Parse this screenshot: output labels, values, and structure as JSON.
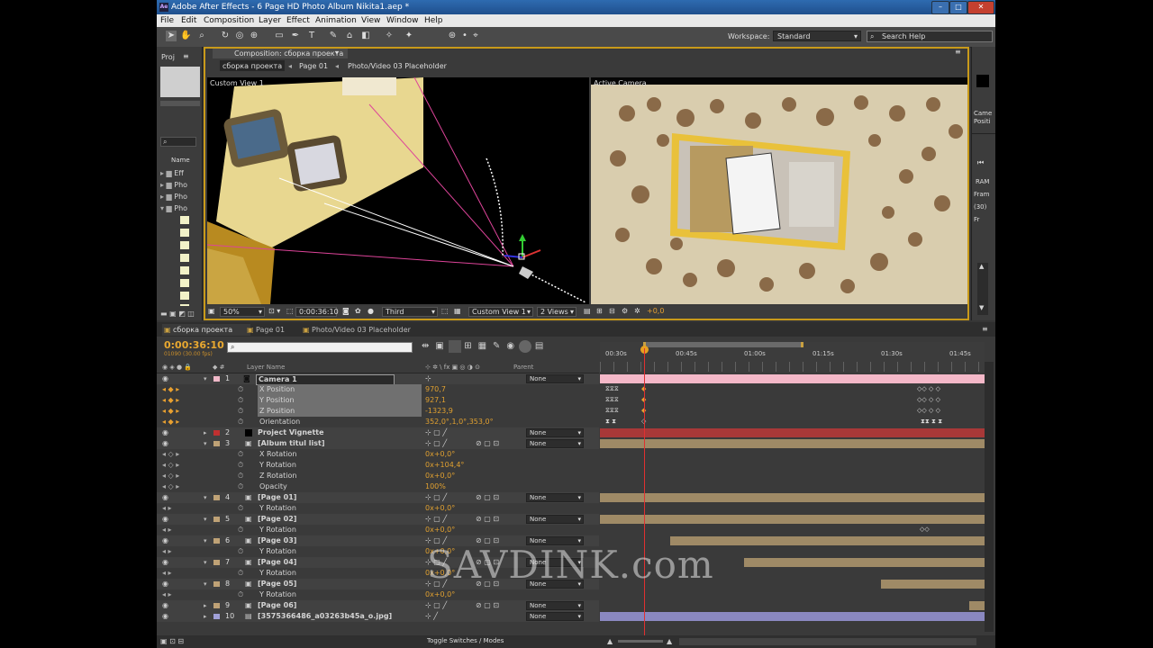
{
  "window": {
    "title": "Adobe After Effects - 6 Page HD Photo Album Nikita1.aep *",
    "minimize": "–",
    "maximize": "□",
    "close": "✕"
  },
  "menu": [
    "File",
    "Edit",
    "Composition",
    "Layer",
    "Effect",
    "Animation",
    "View",
    "Window",
    "Help"
  ],
  "toolbar": {
    "workspace_label": "Workspace:",
    "workspace_value": "Standard",
    "search_placeholder": "Search Help"
  },
  "project_panel": {
    "tab": "Proj",
    "name_col": "Name",
    "items": [
      "Eff",
      "Pho",
      "Pho",
      "Pho"
    ]
  },
  "composition_panel": {
    "tab": "Composition: сборка проекта",
    "breadcrumbs": [
      "сборка проекта",
      "Page 01",
      "Photo/Video 03 Placeholder"
    ],
    "left_view_label": "Custom View 1",
    "right_view_label": "Active Camera",
    "zoom": "50%",
    "timecode": "0:00:36:10",
    "resolution": "Third",
    "view_select": "Custom View 1",
    "views_select": "2 Views",
    "exposure": "+0,0"
  },
  "info_panel": {
    "camera_label": "Came",
    "position_label": "Positi",
    "ram": "RAM",
    "frames": "Fram",
    "frames_value": "(30)",
    "fr": "Fr"
  },
  "timeline": {
    "tabs": [
      "сборка проекта",
      "Page 01",
      "Photo/Video 03 Placeholder"
    ],
    "timecode": "0:00:36:10",
    "frames_info": "01090 (30.00 fps)",
    "col_layer_name": "Layer Name",
    "col_parent": "Parent",
    "ticks": [
      "00:30s",
      "00:45s",
      "01:00s",
      "01:15s",
      "01:30s",
      "01:45s"
    ],
    "toggle_label": "Toggle Switches / Modes",
    "rows": [
      {
        "type": "layer",
        "num": "1",
        "name": "Camera 1",
        "color": "#f0b8c8",
        "parent": "None"
      },
      {
        "type": "prop",
        "name": "X Position",
        "value": "970,7",
        "selected": true
      },
      {
        "type": "prop",
        "name": "Y Position",
        "value": "927,1",
        "selected": true
      },
      {
        "type": "prop",
        "name": "Z Position",
        "value": "-1323,9",
        "selected": true
      },
      {
        "type": "prop",
        "name": "Orientation",
        "value": "352,0°,1,0°,353,0°",
        "selected": false
      },
      {
        "type": "layer",
        "num": "2",
        "name": "Project Vignette",
        "color": "#c03030",
        "parent": "None"
      },
      {
        "type": "layer",
        "num": "3",
        "name": "[Album titul list]",
        "color": "#bfa276",
        "parent": "None"
      },
      {
        "type": "prop",
        "name": "X Rotation",
        "value": "0x+0,0°"
      },
      {
        "type": "prop",
        "name": "Y Rotation",
        "value": "0x+104,4°"
      },
      {
        "type": "prop",
        "name": "Z Rotation",
        "value": "0x+0,0°"
      },
      {
        "type": "prop",
        "name": "Opacity",
        "value": "100%"
      },
      {
        "type": "layer",
        "num": "4",
        "name": "[Page 01]",
        "color": "#bfa276",
        "parent": "None"
      },
      {
        "type": "prop",
        "name": "Y Rotation",
        "value": "0x+0,0°"
      },
      {
        "type": "layer",
        "num": "5",
        "name": "[Page 02]",
        "color": "#bfa276",
        "parent": "None"
      },
      {
        "type": "prop",
        "name": "Y Rotation",
        "value": "0x+0,0°"
      },
      {
        "type": "layer",
        "num": "6",
        "name": "[Page 03]",
        "color": "#bfa276",
        "parent": "None"
      },
      {
        "type": "prop",
        "name": "Y Rotation",
        "value": "0x+0,0°"
      },
      {
        "type": "layer",
        "num": "7",
        "name": "[Page 04]",
        "color": "#bfa276",
        "parent": "None"
      },
      {
        "type": "prop",
        "name": "Y Rotation",
        "value": "0x+0,0°"
      },
      {
        "type": "layer",
        "num": "8",
        "name": "[Page 05]",
        "color": "#bfa276",
        "parent": "None"
      },
      {
        "type": "prop",
        "name": "Y Rotation",
        "value": "0x+0,0°"
      },
      {
        "type": "layer",
        "num": "9",
        "name": "[Page 06]",
        "color": "#bfa276",
        "parent": "None"
      },
      {
        "type": "layer",
        "num": "10",
        "name": "[3575366486_a03263b45a_o.jpg]",
        "color": "#a0a0d8",
        "parent": "None"
      }
    ]
  },
  "watermark": "SAVDINK.com"
}
